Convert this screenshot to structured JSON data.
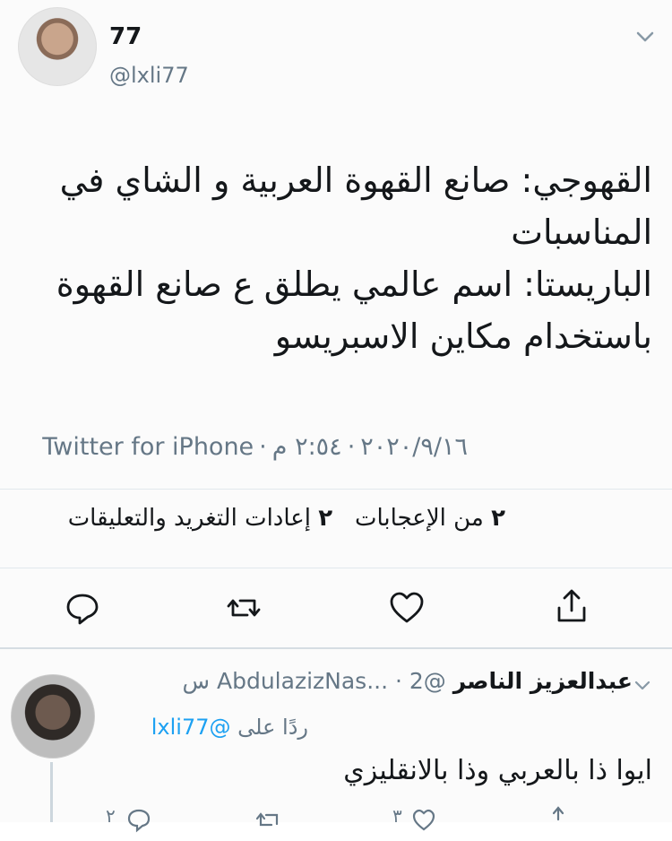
{
  "tweet": {
    "display_name": "77",
    "handle": "@lxli77",
    "text_lines": [
      "القهوجي: صانع القهوة العربية و الشاي في",
      "المناسبات",
      "الباريستا: اسم عالمي يطلق ع صانع القهوة",
      "باستخدام مكاين الاسبريسو"
    ],
    "time": "٢:٥٤ م",
    "date": "٢٠٢٠/٩/١٦",
    "source": "Twitter for iPhone",
    "likes_count": "٢",
    "likes_label": "من الإعجابات",
    "retweets_count": "٢",
    "retweets_label": "إعادات التغريد والتعليقات"
  },
  "icons": {
    "reply": "reply-icon",
    "retweet": "retweet-icon",
    "like": "heart-icon",
    "share": "share-icon",
    "more": "chevron-down-icon"
  },
  "reply": {
    "display_name": "عبدالعزيز الناصر",
    "handle": "@AbdulazizNas...",
    "time": "2 س",
    "replying_prefix": "ردًا على",
    "replying_to": "@lxli77",
    "text": "ايوا ذا بالعربي وذا بالانقليزي",
    "reply_count": "٢",
    "like_count": "٣"
  },
  "colors": {
    "text": "#14171a",
    "muted": "#657786",
    "link": "#1da1f2",
    "divider": "#e1e8ed"
  }
}
